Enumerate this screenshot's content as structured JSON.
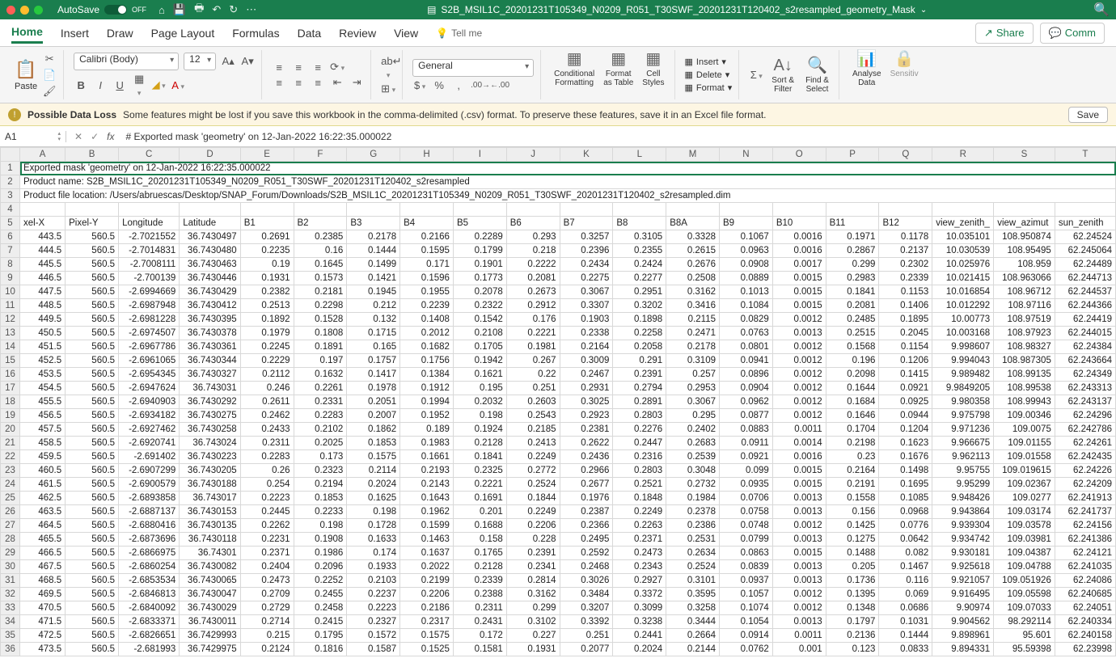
{
  "titlebar": {
    "autosave_label": "AutoSave",
    "autosave_state": "OFF",
    "filename": "S2B_MSIL1C_20201231T105349_N0209_R051_T30SWF_20201231T120402_s2resampled_geometry_Mask"
  },
  "menu": {
    "tabs": [
      "Home",
      "Insert",
      "Draw",
      "Page Layout",
      "Formulas",
      "Data",
      "Review",
      "View"
    ],
    "tellme": "Tell me",
    "share": "Share",
    "comments": "Comm"
  },
  "ribbon": {
    "paste": "Paste",
    "font_name": "Calibri (Body)",
    "font_size": "12",
    "number_format": "General",
    "conditional": "Conditional\nFormatting",
    "format_table": "Format\nas Table",
    "cell_styles": "Cell\nStyles",
    "insert": "Insert",
    "delete": "Delete",
    "format": "Format",
    "sort": "Sort &\nFilter",
    "find": "Find &\nSelect",
    "analyse": "Analyse\nData",
    "sensitivity": "Sensitiv"
  },
  "warning": {
    "title": "Possible Data Loss",
    "text": "Some features might be lost if you save this workbook in the comma-delimited (.csv) format. To preserve these features, save it in an Excel file format.",
    "save": "Save"
  },
  "formula_bar": {
    "cell_ref": "A1",
    "formula": "# Exported mask 'geometry' on 12-Jan-2022 16:22:35.000022"
  },
  "columns": [
    "A",
    "B",
    "C",
    "D",
    "E",
    "F",
    "G",
    "H",
    "I",
    "J",
    "K",
    "L",
    "M",
    "N",
    "O",
    "P",
    "Q",
    "R",
    "S",
    "T"
  ],
  "row_headers": [
    "1",
    "2",
    "3",
    "4",
    "5",
    "6",
    "7",
    "8",
    "9",
    "10",
    "11",
    "12",
    "13",
    "14",
    "15",
    "16",
    "17",
    "18",
    "19",
    "20",
    "21",
    "22",
    "23",
    "24",
    "25",
    "26",
    "27",
    "28",
    "29",
    "30",
    "31",
    "32",
    "33",
    "34",
    "35",
    "36"
  ],
  "meta_rows": {
    "r1": "Exported mask 'geometry' on 12-Jan-2022 16:22:35.000022",
    "r2": "Product name: S2B_MSIL1C_20201231T105349_N0209_R051_T30SWF_20201231T120402_s2resampled",
    "r3": "Product file location: /Users/abruescas/Desktop/SNAP_Forum/Downloads/S2B_MSIL1C_20201231T105349_N0209_R051_T30SWF_20201231T120402_s2resampled.dim"
  },
  "headers_row": [
    "xel-X",
    "Pixel-Y",
    "Longitude",
    "Latitude",
    "B1",
    "B2",
    "B3",
    "B4",
    "B5",
    "B6",
    "B7",
    "B8",
    "B8A",
    "B9",
    "B10",
    "B11",
    "B12",
    "view_zenith_",
    "view_azimut",
    "sun_zenith"
  ],
  "data": [
    [
      "443.5",
      "560.5",
      "-2.7021552",
      "36.7430497",
      "0.2691",
      "0.2385",
      "0.2178",
      "0.2166",
      "0.2289",
      "0.293",
      "0.3257",
      "0.3105",
      "0.3328",
      "0.1067",
      "0.0016",
      "0.1971",
      "0.1178",
      "10.035101",
      "108.950874",
      "62.24524"
    ],
    [
      "444.5",
      "560.5",
      "-2.7014831",
      "36.7430480",
      "0.2235",
      "0.16",
      "0.1444",
      "0.1595",
      "0.1799",
      "0.218",
      "0.2396",
      "0.2355",
      "0.2615",
      "0.0963",
      "0.0016",
      "0.2867",
      "0.2137",
      "10.030539",
      "108.95495",
      "62.245064"
    ],
    [
      "445.5",
      "560.5",
      "-2.7008111",
      "36.7430463",
      "0.19",
      "0.1645",
      "0.1499",
      "0.171",
      "0.1901",
      "0.2222",
      "0.2434",
      "0.2424",
      "0.2676",
      "0.0908",
      "0.0017",
      "0.299",
      "0.2302",
      "10.025976",
      "108.959",
      "62.24489"
    ],
    [
      "446.5",
      "560.5",
      "-2.700139",
      "36.7430446",
      "0.1931",
      "0.1573",
      "0.1421",
      "0.1596",
      "0.1773",
      "0.2081",
      "0.2275",
      "0.2277",
      "0.2508",
      "0.0889",
      "0.0015",
      "0.2983",
      "0.2339",
      "10.021415",
      "108.963066",
      "62.244713"
    ],
    [
      "447.5",
      "560.5",
      "-2.6994669",
      "36.7430429",
      "0.2382",
      "0.2181",
      "0.1945",
      "0.1955",
      "0.2078",
      "0.2673",
      "0.3067",
      "0.2951",
      "0.3162",
      "0.1013",
      "0.0015",
      "0.1841",
      "0.1153",
      "10.016854",
      "108.96712",
      "62.244537"
    ],
    [
      "448.5",
      "560.5",
      "-2.6987948",
      "36.7430412",
      "0.2513",
      "0.2298",
      "0.212",
      "0.2239",
      "0.2322",
      "0.2912",
      "0.3307",
      "0.3202",
      "0.3416",
      "0.1084",
      "0.0015",
      "0.2081",
      "0.1406",
      "10.012292",
      "108.97116",
      "62.244366"
    ],
    [
      "449.5",
      "560.5",
      "-2.6981228",
      "36.7430395",
      "0.1892",
      "0.1528",
      "0.132",
      "0.1408",
      "0.1542",
      "0.176",
      "0.1903",
      "0.1898",
      "0.2115",
      "0.0829",
      "0.0012",
      "0.2485",
      "0.1895",
      "10.00773",
      "108.97519",
      "62.24419"
    ],
    [
      "450.5",
      "560.5",
      "-2.6974507",
      "36.7430378",
      "0.1979",
      "0.1808",
      "0.1715",
      "0.2012",
      "0.2108",
      "0.2221",
      "0.2338",
      "0.2258",
      "0.2471",
      "0.0763",
      "0.0013",
      "0.2515",
      "0.2045",
      "10.003168",
      "108.97923",
      "62.244015"
    ],
    [
      "451.5",
      "560.5",
      "-2.6967786",
      "36.7430361",
      "0.2245",
      "0.1891",
      "0.165",
      "0.1682",
      "0.1705",
      "0.1981",
      "0.2164",
      "0.2058",
      "0.2178",
      "0.0801",
      "0.0012",
      "0.1568",
      "0.1154",
      "9.998607",
      "108.98327",
      "62.24384"
    ],
    [
      "452.5",
      "560.5",
      "-2.6961065",
      "36.7430344",
      "0.2229",
      "0.197",
      "0.1757",
      "0.1756",
      "0.1942",
      "0.267",
      "0.3009",
      "0.291",
      "0.3109",
      "0.0941",
      "0.0012",
      "0.196",
      "0.1206",
      "9.994043",
      "108.987305",
      "62.243664"
    ],
    [
      "453.5",
      "560.5",
      "-2.6954345",
      "36.7430327",
      "0.2112",
      "0.1632",
      "0.1417",
      "0.1384",
      "0.1621",
      "0.22",
      "0.2467",
      "0.2391",
      "0.257",
      "0.0896",
      "0.0012",
      "0.2098",
      "0.1415",
      "9.989482",
      "108.99135",
      "62.24349"
    ],
    [
      "454.5",
      "560.5",
      "-2.6947624",
      "36.743031",
      "0.246",
      "0.2261",
      "0.1978",
      "0.1912",
      "0.195",
      "0.251",
      "0.2931",
      "0.2794",
      "0.2953",
      "0.0904",
      "0.0012",
      "0.1644",
      "0.0921",
      "9.9849205",
      "108.99538",
      "62.243313"
    ],
    [
      "455.5",
      "560.5",
      "-2.6940903",
      "36.7430292",
      "0.2611",
      "0.2331",
      "0.2051",
      "0.1994",
      "0.2032",
      "0.2603",
      "0.3025",
      "0.2891",
      "0.3067",
      "0.0962",
      "0.0012",
      "0.1684",
      "0.0925",
      "9.980358",
      "108.99943",
      "62.243137"
    ],
    [
      "456.5",
      "560.5",
      "-2.6934182",
      "36.7430275",
      "0.2462",
      "0.2283",
      "0.2007",
      "0.1952",
      "0.198",
      "0.2543",
      "0.2923",
      "0.2803",
      "0.295",
      "0.0877",
      "0.0012",
      "0.1646",
      "0.0944",
      "9.975798",
      "109.00346",
      "62.24296"
    ],
    [
      "457.5",
      "560.5",
      "-2.6927462",
      "36.7430258",
      "0.2433",
      "0.2102",
      "0.1862",
      "0.189",
      "0.1924",
      "0.2185",
      "0.2381",
      "0.2276",
      "0.2402",
      "0.0883",
      "0.0011",
      "0.1704",
      "0.1204",
      "9.971236",
      "109.0075",
      "62.242786"
    ],
    [
      "458.5",
      "560.5",
      "-2.6920741",
      "36.743024",
      "0.2311",
      "0.2025",
      "0.1853",
      "0.1983",
      "0.2128",
      "0.2413",
      "0.2622",
      "0.2447",
      "0.2683",
      "0.0911",
      "0.0014",
      "0.2198",
      "0.1623",
      "9.966675",
      "109.01155",
      "62.24261"
    ],
    [
      "459.5",
      "560.5",
      "-2.691402",
      "36.7430223",
      "0.2283",
      "0.173",
      "0.1575",
      "0.1661",
      "0.1841",
      "0.2249",
      "0.2436",
      "0.2316",
      "0.2539",
      "0.0921",
      "0.0016",
      "0.23",
      "0.1676",
      "9.962113",
      "109.01558",
      "62.242435"
    ],
    [
      "460.5",
      "560.5",
      "-2.6907299",
      "36.7430205",
      "0.26",
      "0.2323",
      "0.2114",
      "0.2193",
      "0.2325",
      "0.2772",
      "0.2966",
      "0.2803",
      "0.3048",
      "0.099",
      "0.0015",
      "0.2164",
      "0.1498",
      "9.95755",
      "109.019615",
      "62.24226"
    ],
    [
      "461.5",
      "560.5",
      "-2.6900579",
      "36.7430188",
      "0.254",
      "0.2194",
      "0.2024",
      "0.2143",
      "0.2221",
      "0.2524",
      "0.2677",
      "0.2521",
      "0.2732",
      "0.0935",
      "0.0015",
      "0.2191",
      "0.1695",
      "9.95299",
      "109.02367",
      "62.24209"
    ],
    [
      "462.5",
      "560.5",
      "-2.6893858",
      "36.743017",
      "0.2223",
      "0.1853",
      "0.1625",
      "0.1643",
      "0.1691",
      "0.1844",
      "0.1976",
      "0.1848",
      "0.1984",
      "0.0706",
      "0.0013",
      "0.1558",
      "0.1085",
      "9.948426",
      "109.0277",
      "62.241913"
    ],
    [
      "463.5",
      "560.5",
      "-2.6887137",
      "36.7430153",
      "0.2445",
      "0.2233",
      "0.198",
      "0.1962",
      "0.201",
      "0.2249",
      "0.2387",
      "0.2249",
      "0.2378",
      "0.0758",
      "0.0013",
      "0.156",
      "0.0968",
      "9.943864",
      "109.03174",
      "62.241737"
    ],
    [
      "464.5",
      "560.5",
      "-2.6880416",
      "36.7430135",
      "0.2262",
      "0.198",
      "0.1728",
      "0.1599",
      "0.1688",
      "0.2206",
      "0.2366",
      "0.2263",
      "0.2386",
      "0.0748",
      "0.0012",
      "0.1425",
      "0.0776",
      "9.939304",
      "109.03578",
      "62.24156"
    ],
    [
      "465.5",
      "560.5",
      "-2.6873696",
      "36.7430118",
      "0.2231",
      "0.1908",
      "0.1633",
      "0.1463",
      "0.158",
      "0.228",
      "0.2495",
      "0.2371",
      "0.2531",
      "0.0799",
      "0.0013",
      "0.1275",
      "0.0642",
      "9.934742",
      "109.03981",
      "62.241386"
    ],
    [
      "466.5",
      "560.5",
      "-2.6866975",
      "36.74301",
      "0.2371",
      "0.1986",
      "0.174",
      "0.1637",
      "0.1765",
      "0.2391",
      "0.2592",
      "0.2473",
      "0.2634",
      "0.0863",
      "0.0015",
      "0.1488",
      "0.082",
      "9.930181",
      "109.04387",
      "62.24121"
    ],
    [
      "467.5",
      "560.5",
      "-2.6860254",
      "36.7430082",
      "0.2404",
      "0.2096",
      "0.1933",
      "0.2022",
      "0.2128",
      "0.2341",
      "0.2468",
      "0.2343",
      "0.2524",
      "0.0839",
      "0.0013",
      "0.205",
      "0.1467",
      "9.925618",
      "109.04788",
      "62.241035"
    ],
    [
      "468.5",
      "560.5",
      "-2.6853534",
      "36.7430065",
      "0.2473",
      "0.2252",
      "0.2103",
      "0.2199",
      "0.2339",
      "0.2814",
      "0.3026",
      "0.2927",
      "0.3101",
      "0.0937",
      "0.0013",
      "0.1736",
      "0.116",
      "9.921057",
      "109.051926",
      "62.24086"
    ],
    [
      "469.5",
      "560.5",
      "-2.6846813",
      "36.7430047",
      "0.2709",
      "0.2455",
      "0.2237",
      "0.2206",
      "0.2388",
      "0.3162",
      "0.3484",
      "0.3372",
      "0.3595",
      "0.1057",
      "0.0012",
      "0.1395",
      "0.069",
      "9.916495",
      "109.05598",
      "62.240685"
    ],
    [
      "470.5",
      "560.5",
      "-2.6840092",
      "36.7430029",
      "0.2729",
      "0.2458",
      "0.2223",
      "0.2186",
      "0.2311",
      "0.299",
      "0.3207",
      "0.3099",
      "0.3258",
      "0.1074",
      "0.0012",
      "0.1348",
      "0.0686",
      "9.90974",
      "109.07033",
      "62.24051"
    ],
    [
      "471.5",
      "560.5",
      "-2.6833371",
      "36.7430011",
      "0.2714",
      "0.2415",
      "0.2327",
      "0.2317",
      "0.2431",
      "0.3102",
      "0.3392",
      "0.3238",
      "0.3444",
      "0.1054",
      "0.0013",
      "0.1797",
      "0.1031",
      "9.904562",
      "98.292114",
      "62.240334"
    ],
    [
      "472.5",
      "560.5",
      "-2.6826651",
      "36.7429993",
      "0.215",
      "0.1795",
      "0.1572",
      "0.1575",
      "0.172",
      "0.227",
      "0.251",
      "0.2441",
      "0.2664",
      "0.0914",
      "0.0011",
      "0.2136",
      "0.1444",
      "9.898961",
      "95.601",
      "62.240158"
    ],
    [
      "473.5",
      "560.5",
      "-2.681993",
      "36.7429975",
      "0.2124",
      "0.1816",
      "0.1587",
      "0.1525",
      "0.1581",
      "0.1931",
      "0.2077",
      "0.2024",
      "0.2144",
      "0.0762",
      "0.001",
      "0.123",
      "0.0833",
      "9.894331",
      "95.59398",
      "62.23998"
    ]
  ]
}
